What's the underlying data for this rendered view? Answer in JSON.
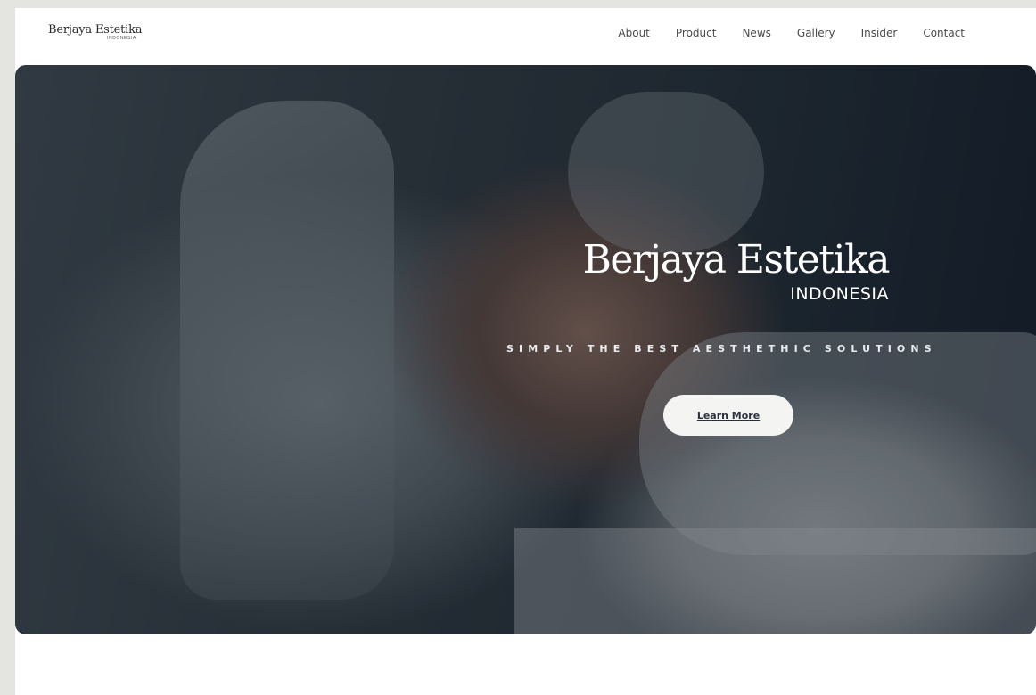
{
  "header": {
    "logo_name": "Berjaya Estetika",
    "logo_sub": "INDONESIA",
    "nav": [
      "About",
      "Product",
      "News",
      "Gallery",
      "Insider",
      "Contact"
    ]
  },
  "hero": {
    "title": "Berjaya Estetika",
    "subtitle": "INDONESIA",
    "tagline": "SIMPLY THE BEST AESTHETHIC SOLUTIONS",
    "button_label": "Learn More"
  },
  "colors": {
    "page_bg": "#e4e4e0",
    "header_bg": "#ffffff",
    "hero_overlay": "#161e26",
    "button_bg": "#f4f4f2",
    "button_text": "#2a2f3a"
  }
}
